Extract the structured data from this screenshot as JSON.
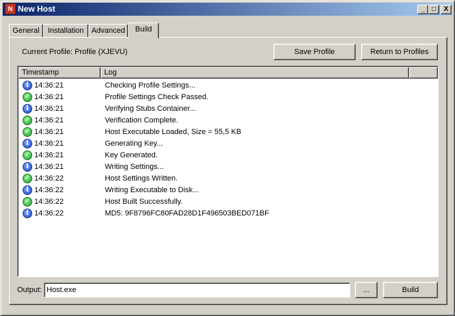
{
  "window": {
    "title": "New Host",
    "icon_name": "app-icon",
    "controls": {
      "minimize": "_",
      "maximize": "□",
      "close": "X"
    }
  },
  "tabs": [
    {
      "label": "General"
    },
    {
      "label": "Installation"
    },
    {
      "label": "Advanced"
    },
    {
      "label": "Build",
      "active": true
    }
  ],
  "profile": {
    "label": "Current Profile: Profile (XJEVU)"
  },
  "buttons": {
    "save_profile": "Save Profile",
    "return_to_profiles": "Return to Profiles",
    "browse": "...",
    "build": "Build"
  },
  "log": {
    "columns": [
      "Timestamp",
      "Log"
    ],
    "rows": [
      {
        "icon": "info",
        "time": "14:36:21",
        "message": "Checking Profile Settings..."
      },
      {
        "icon": "ok",
        "time": "14:36:21",
        "message": "Profile Settings Check Passed."
      },
      {
        "icon": "info",
        "time": "14:36:21",
        "message": "Verifying Stubs Container..."
      },
      {
        "icon": "ok",
        "time": "14:36:21",
        "message": "Verification Complete."
      },
      {
        "icon": "ok",
        "time": "14:36:21",
        "message": "Host Executable Loaded, Size = 55,5 KB"
      },
      {
        "icon": "info",
        "time": "14:36:21",
        "message": "Generating Key..."
      },
      {
        "icon": "ok",
        "time": "14:36:21",
        "message": "Key Generated."
      },
      {
        "icon": "info",
        "time": "14:36:21",
        "message": "Writing Settings..."
      },
      {
        "icon": "ok",
        "time": "14:36:22",
        "message": "Host Settings Written."
      },
      {
        "icon": "info",
        "time": "14:36:22",
        "message": "Writing Executable to Disk..."
      },
      {
        "icon": "ok",
        "time": "14:36:22",
        "message": "Host Built Successfully."
      },
      {
        "icon": "info",
        "time": "14:36:22",
        "message": "MD5: 9F8796FC80FAD28D1F496503BED071BF"
      }
    ]
  },
  "output": {
    "label": "Output:",
    "value": "Host.exe"
  },
  "colors": {
    "face": "#d4d0c8",
    "title_start": "#0a246a",
    "title_end": "#a6caf0",
    "info": "#1c48c8",
    "ok": "#1e9e2c"
  }
}
